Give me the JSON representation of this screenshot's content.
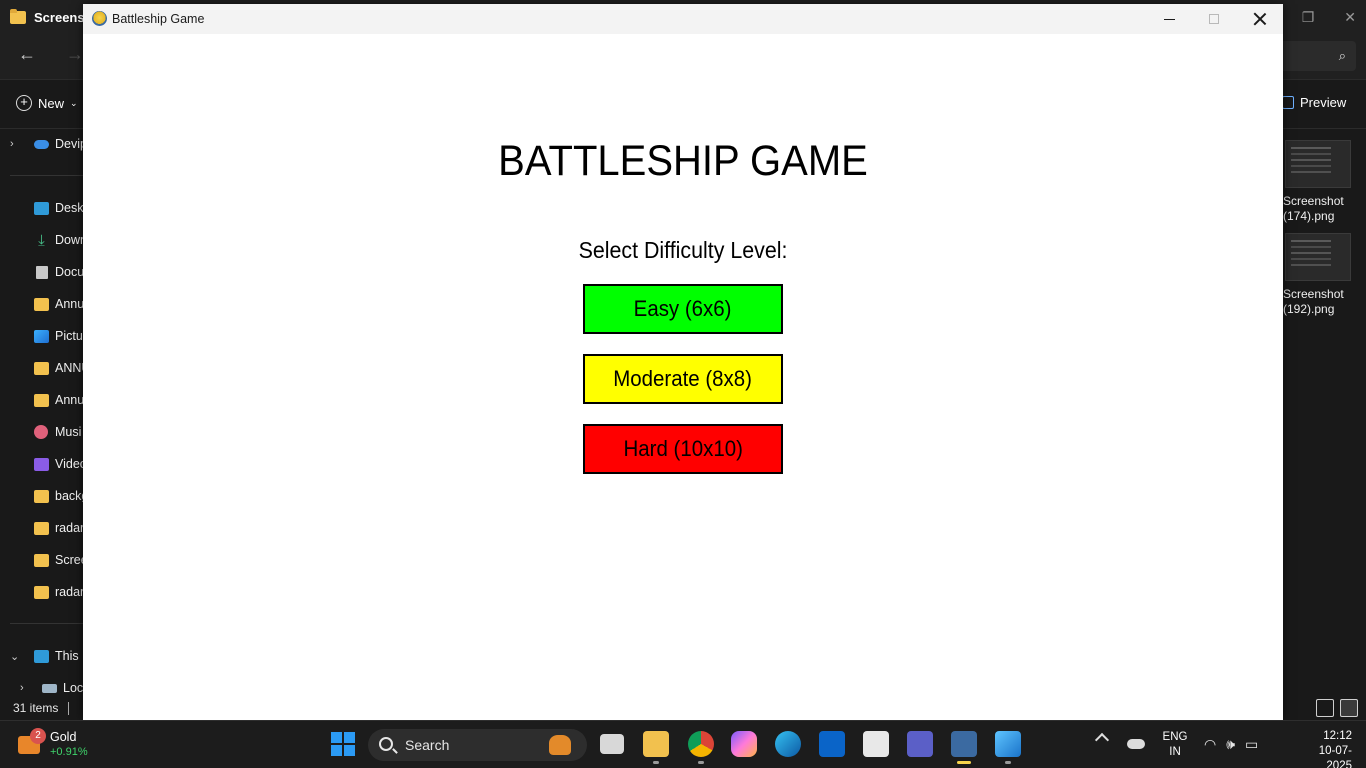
{
  "explorer": {
    "title": "Screens",
    "sidebar": {
      "top_item": "Devip",
      "items": [
        "Deskt",
        "Down",
        "Docu",
        "Annu",
        "Pictu",
        "ANNU",
        "Annu",
        "Musi",
        "Video",
        "backg",
        "radar",
        "Scree",
        "radar"
      ],
      "this_pc": "This P",
      "local_disk": "Loc"
    },
    "command_bar": {
      "new_label": "New",
      "preview_label": "Preview"
    },
    "thumbnails": [
      {
        "line1": "Screenshot",
        "line2": "(174).png"
      },
      {
        "line1": "Screenshot",
        "line2": "(192).png"
      }
    ],
    "status": {
      "items_count": "31 items"
    }
  },
  "game_window": {
    "title": "Battleship Game",
    "heading": "BATTLESHIP GAME",
    "difficulty_label": "Select Difficulty Level:",
    "buttons": {
      "easy": {
        "label": "Easy (6x6)",
        "color": "#00ff00"
      },
      "moderate": {
        "label": "Moderate (8x8)",
        "color": "#ffff00"
      },
      "hard": {
        "label": "Hard (10x10)",
        "color": "#ff0000"
      }
    }
  },
  "taskbar": {
    "widget": {
      "badge": "2",
      "name": "Gold",
      "change": "+0.91%"
    },
    "search_label": "Search",
    "tray": {
      "lang_line1": "ENG",
      "lang_line2": "IN",
      "time": "12:12",
      "date": "10-07-2025"
    }
  }
}
